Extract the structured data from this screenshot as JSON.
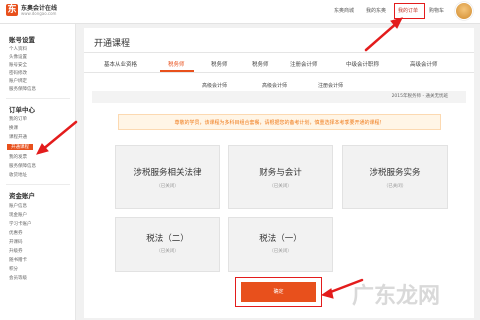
{
  "header": {
    "logo_mark": "东",
    "logo_name": "东奥会计在线",
    "logo_url": "www.dongao.com",
    "nav": [
      "东奥商城",
      "我的东奥",
      "我的订单",
      "购物车"
    ],
    "active_nav": "我的订单"
  },
  "sidebar": {
    "sections": [
      {
        "title": "账号设置",
        "items": [
          "个人资料",
          "头像设置",
          "账号安全",
          "密码修改",
          "账户绑定",
          "服务保障信息"
        ]
      },
      {
        "title": "订单中心",
        "items": [
          "我的订单",
          "换课",
          "课程开通",
          "开通课程",
          "我的发票",
          "服务保障信息",
          "收货地址"
        ]
      },
      {
        "title": "资金账户",
        "items": [
          "账户信息",
          "现金账户",
          "学习卡账户",
          "优惠券",
          "开课码",
          "升级券",
          "随书赠卡",
          "积分",
          "会员等级"
        ]
      }
    ],
    "active_item": "开通课程"
  },
  "main": {
    "title": "开通课程",
    "tabs_row1": [
      "基本从业资格",
      "税务师",
      "税务师",
      "税务师",
      "注册会计师",
      "中级会计职称",
      "高级会计师"
    ],
    "tabs_row2": [
      "高级会计师",
      "高级会计师",
      "注册会计师"
    ],
    "subhead": "2015年税务师 - 通关无忧班",
    "notice": "尊敬的学员，该课程为多科目组合套餐，请根据您的备考计划，慎重选择本考季要开通的课程！",
    "cards": [
      {
        "title": "涉税服务相关法律",
        "status": "（已关闭）"
      },
      {
        "title": "财务与会计",
        "status": "（已关闭）"
      },
      {
        "title": "涉税服务实务",
        "status": "（已关闭）"
      },
      {
        "title": "税法（二）",
        "status": "（已关闭）"
      },
      {
        "title": "税法（一）",
        "status": "（已关闭）"
      }
    ],
    "confirm_label": "确定"
  },
  "watermark": "广东龙网",
  "colors": {
    "accent": "#e8501c",
    "highlight_red": "#e31c1c",
    "notice_text": "#f07a19"
  }
}
